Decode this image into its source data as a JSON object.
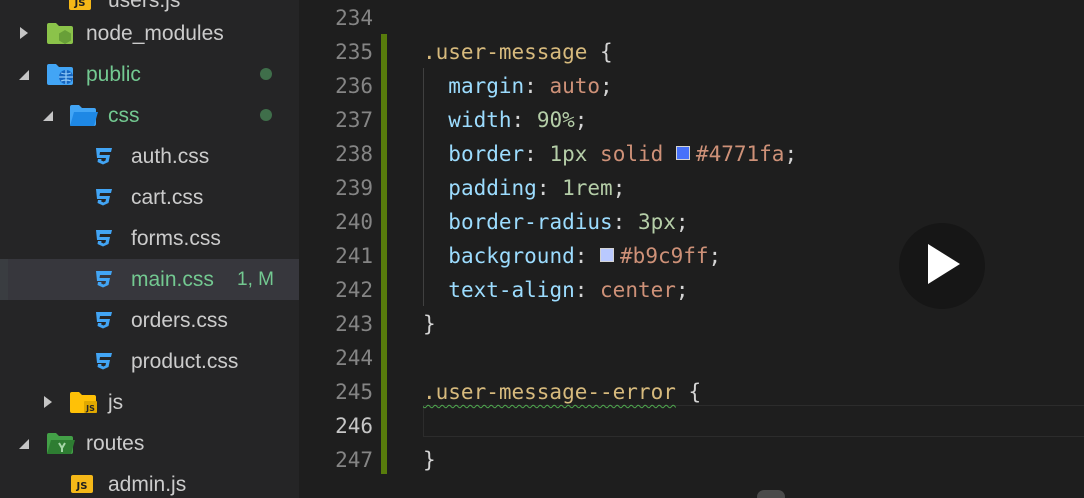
{
  "explorer": {
    "items": [
      {
        "label": "users.js",
        "type": "js-file"
      },
      {
        "label": "node_modules",
        "type": "folder",
        "state": "collapsed"
      },
      {
        "label": "public",
        "type": "folder",
        "state": "expanded",
        "modified": true
      },
      {
        "label": "css",
        "type": "folder",
        "state": "expanded",
        "modified": true
      },
      {
        "label": "auth.css",
        "type": "css-file"
      },
      {
        "label": "cart.css",
        "type": "css-file"
      },
      {
        "label": "forms.css",
        "type": "css-file"
      },
      {
        "label": "main.css",
        "type": "css-file",
        "selected": true,
        "decoration": "1, M"
      },
      {
        "label": "orders.css",
        "type": "css-file"
      },
      {
        "label": "product.css",
        "type": "css-file"
      },
      {
        "label": "js",
        "type": "folder",
        "state": "collapsed"
      },
      {
        "label": "routes",
        "type": "folder",
        "state": "expanded"
      },
      {
        "label": "admin.js",
        "type": "js-file"
      }
    ]
  },
  "editor": {
    "active_line": "246",
    "lines": [
      {
        "n": "234",
        "tokens": []
      },
      {
        "n": "235",
        "tokens": [
          {
            "t": ".user-message",
            "k": "sel"
          },
          {
            "t": " {",
            "k": "punc"
          }
        ]
      },
      {
        "n": "236",
        "tokens": [
          {
            "t": "  "
          },
          {
            "t": "margin",
            "k": "prop"
          },
          {
            "t": ": ",
            "k": "punc"
          },
          {
            "t": "auto",
            "k": "val"
          },
          {
            "t": ";",
            "k": "punc"
          }
        ]
      },
      {
        "n": "237",
        "tokens": [
          {
            "t": "  "
          },
          {
            "t": "width",
            "k": "prop"
          },
          {
            "t": ": ",
            "k": "punc"
          },
          {
            "t": "90%",
            "k": "num"
          },
          {
            "t": ";",
            "k": "punc"
          }
        ]
      },
      {
        "n": "238",
        "tokens": [
          {
            "t": "  "
          },
          {
            "t": "border",
            "k": "prop"
          },
          {
            "t": ": ",
            "k": "punc"
          },
          {
            "t": "1px",
            "k": "num"
          },
          {
            "t": " "
          },
          {
            "t": "solid",
            "k": "val"
          },
          {
            "t": " "
          },
          {
            "swatch": "#4771fa"
          },
          {
            "t": "#4771fa",
            "k": "val"
          },
          {
            "t": ";",
            "k": "punc"
          }
        ]
      },
      {
        "n": "239",
        "tokens": [
          {
            "t": "  "
          },
          {
            "t": "padding",
            "k": "prop"
          },
          {
            "t": ": ",
            "k": "punc"
          },
          {
            "t": "1rem",
            "k": "num"
          },
          {
            "t": ";",
            "k": "punc"
          }
        ]
      },
      {
        "n": "240",
        "tokens": [
          {
            "t": "  "
          },
          {
            "t": "border-radius",
            "k": "prop"
          },
          {
            "t": ": ",
            "k": "punc"
          },
          {
            "t": "3px",
            "k": "num"
          },
          {
            "t": ";",
            "k": "punc"
          }
        ]
      },
      {
        "n": "241",
        "tokens": [
          {
            "t": "  "
          },
          {
            "t": "background",
            "k": "prop"
          },
          {
            "t": ": ",
            "k": "punc"
          },
          {
            "swatch": "#b9c9ff"
          },
          {
            "t": "#b9c9ff",
            "k": "val"
          },
          {
            "t": ";",
            "k": "punc"
          }
        ]
      },
      {
        "n": "242",
        "tokens": [
          {
            "t": "  "
          },
          {
            "t": "text-align",
            "k": "prop"
          },
          {
            "t": ": ",
            "k": "punc"
          },
          {
            "t": "center",
            "k": "val"
          },
          {
            "t": ";",
            "k": "punc"
          }
        ]
      },
      {
        "n": "243",
        "tokens": [
          {
            "t": "}",
            "k": "punc"
          }
        ]
      },
      {
        "n": "244",
        "tokens": []
      },
      {
        "n": "245",
        "tokens": [
          {
            "t": ".user-message--error",
            "k": "sel",
            "squiggle": true
          },
          {
            "t": " {",
            "k": "punc"
          }
        ]
      },
      {
        "n": "246",
        "tokens": []
      },
      {
        "n": "247",
        "tokens": [
          {
            "t": "}",
            "k": "punc"
          }
        ]
      }
    ]
  },
  "colors": {
    "sidebar_bg": "#252526",
    "editor_bg": "#1e1e1e",
    "modified_green": "#73c991",
    "css_icon": "#42a5f5",
    "folder_blue": "#42a5f5",
    "folder_green": "#8bc34a",
    "js_icon": "#f5b818"
  },
  "overlay": {
    "icon": "play-icon"
  }
}
